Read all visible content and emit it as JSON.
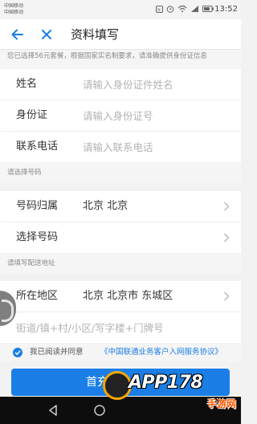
{
  "status_bar": {
    "carrier_1": "中国移动",
    "carrier_2": "中国移动",
    "time": "13:52",
    "icons": [
      "nfc-icon",
      "alarm-icon",
      "wifi-icon",
      "signal-icon",
      "battery-icon"
    ]
  },
  "header": {
    "back_icon": "arrow-left-icon",
    "close_icon": "close-icon",
    "title": "资料填写",
    "accent_color": "#1a7ee6"
  },
  "notice": "您已选择56元套餐，根据国家实名制要求，请准确提供身份证信息",
  "personal": {
    "name_label": "姓名",
    "name_placeholder": "请输入身份证件姓名",
    "id_label": "身份证",
    "id_placeholder": "请输入身份证号",
    "phone_label": "联系电话",
    "phone_placeholder": "请输入联系电话"
  },
  "number_section": {
    "title": "请选择号码",
    "location_label": "号码归属",
    "location_value": "北京 北京",
    "select_label": "选择号码"
  },
  "address_section": {
    "title": "请填写配送地址",
    "region_label": "所在地区",
    "region_value": "北京 北京市 东城区",
    "street_placeholder": "街道/镇+村/小区/写字楼+门牌号"
  },
  "agreement": {
    "checked": true,
    "prefix": "我已阅读并同意",
    "link": "《中国联通业务客户入网服务协议》"
  },
  "submit_label": "首充话",
  "nav_bar": {
    "icons": [
      "back-triangle-icon",
      "home-circle-icon",
      "recent-square-icon"
    ]
  },
  "watermark": {
    "text": "APP178",
    "sub": "手游网"
  }
}
